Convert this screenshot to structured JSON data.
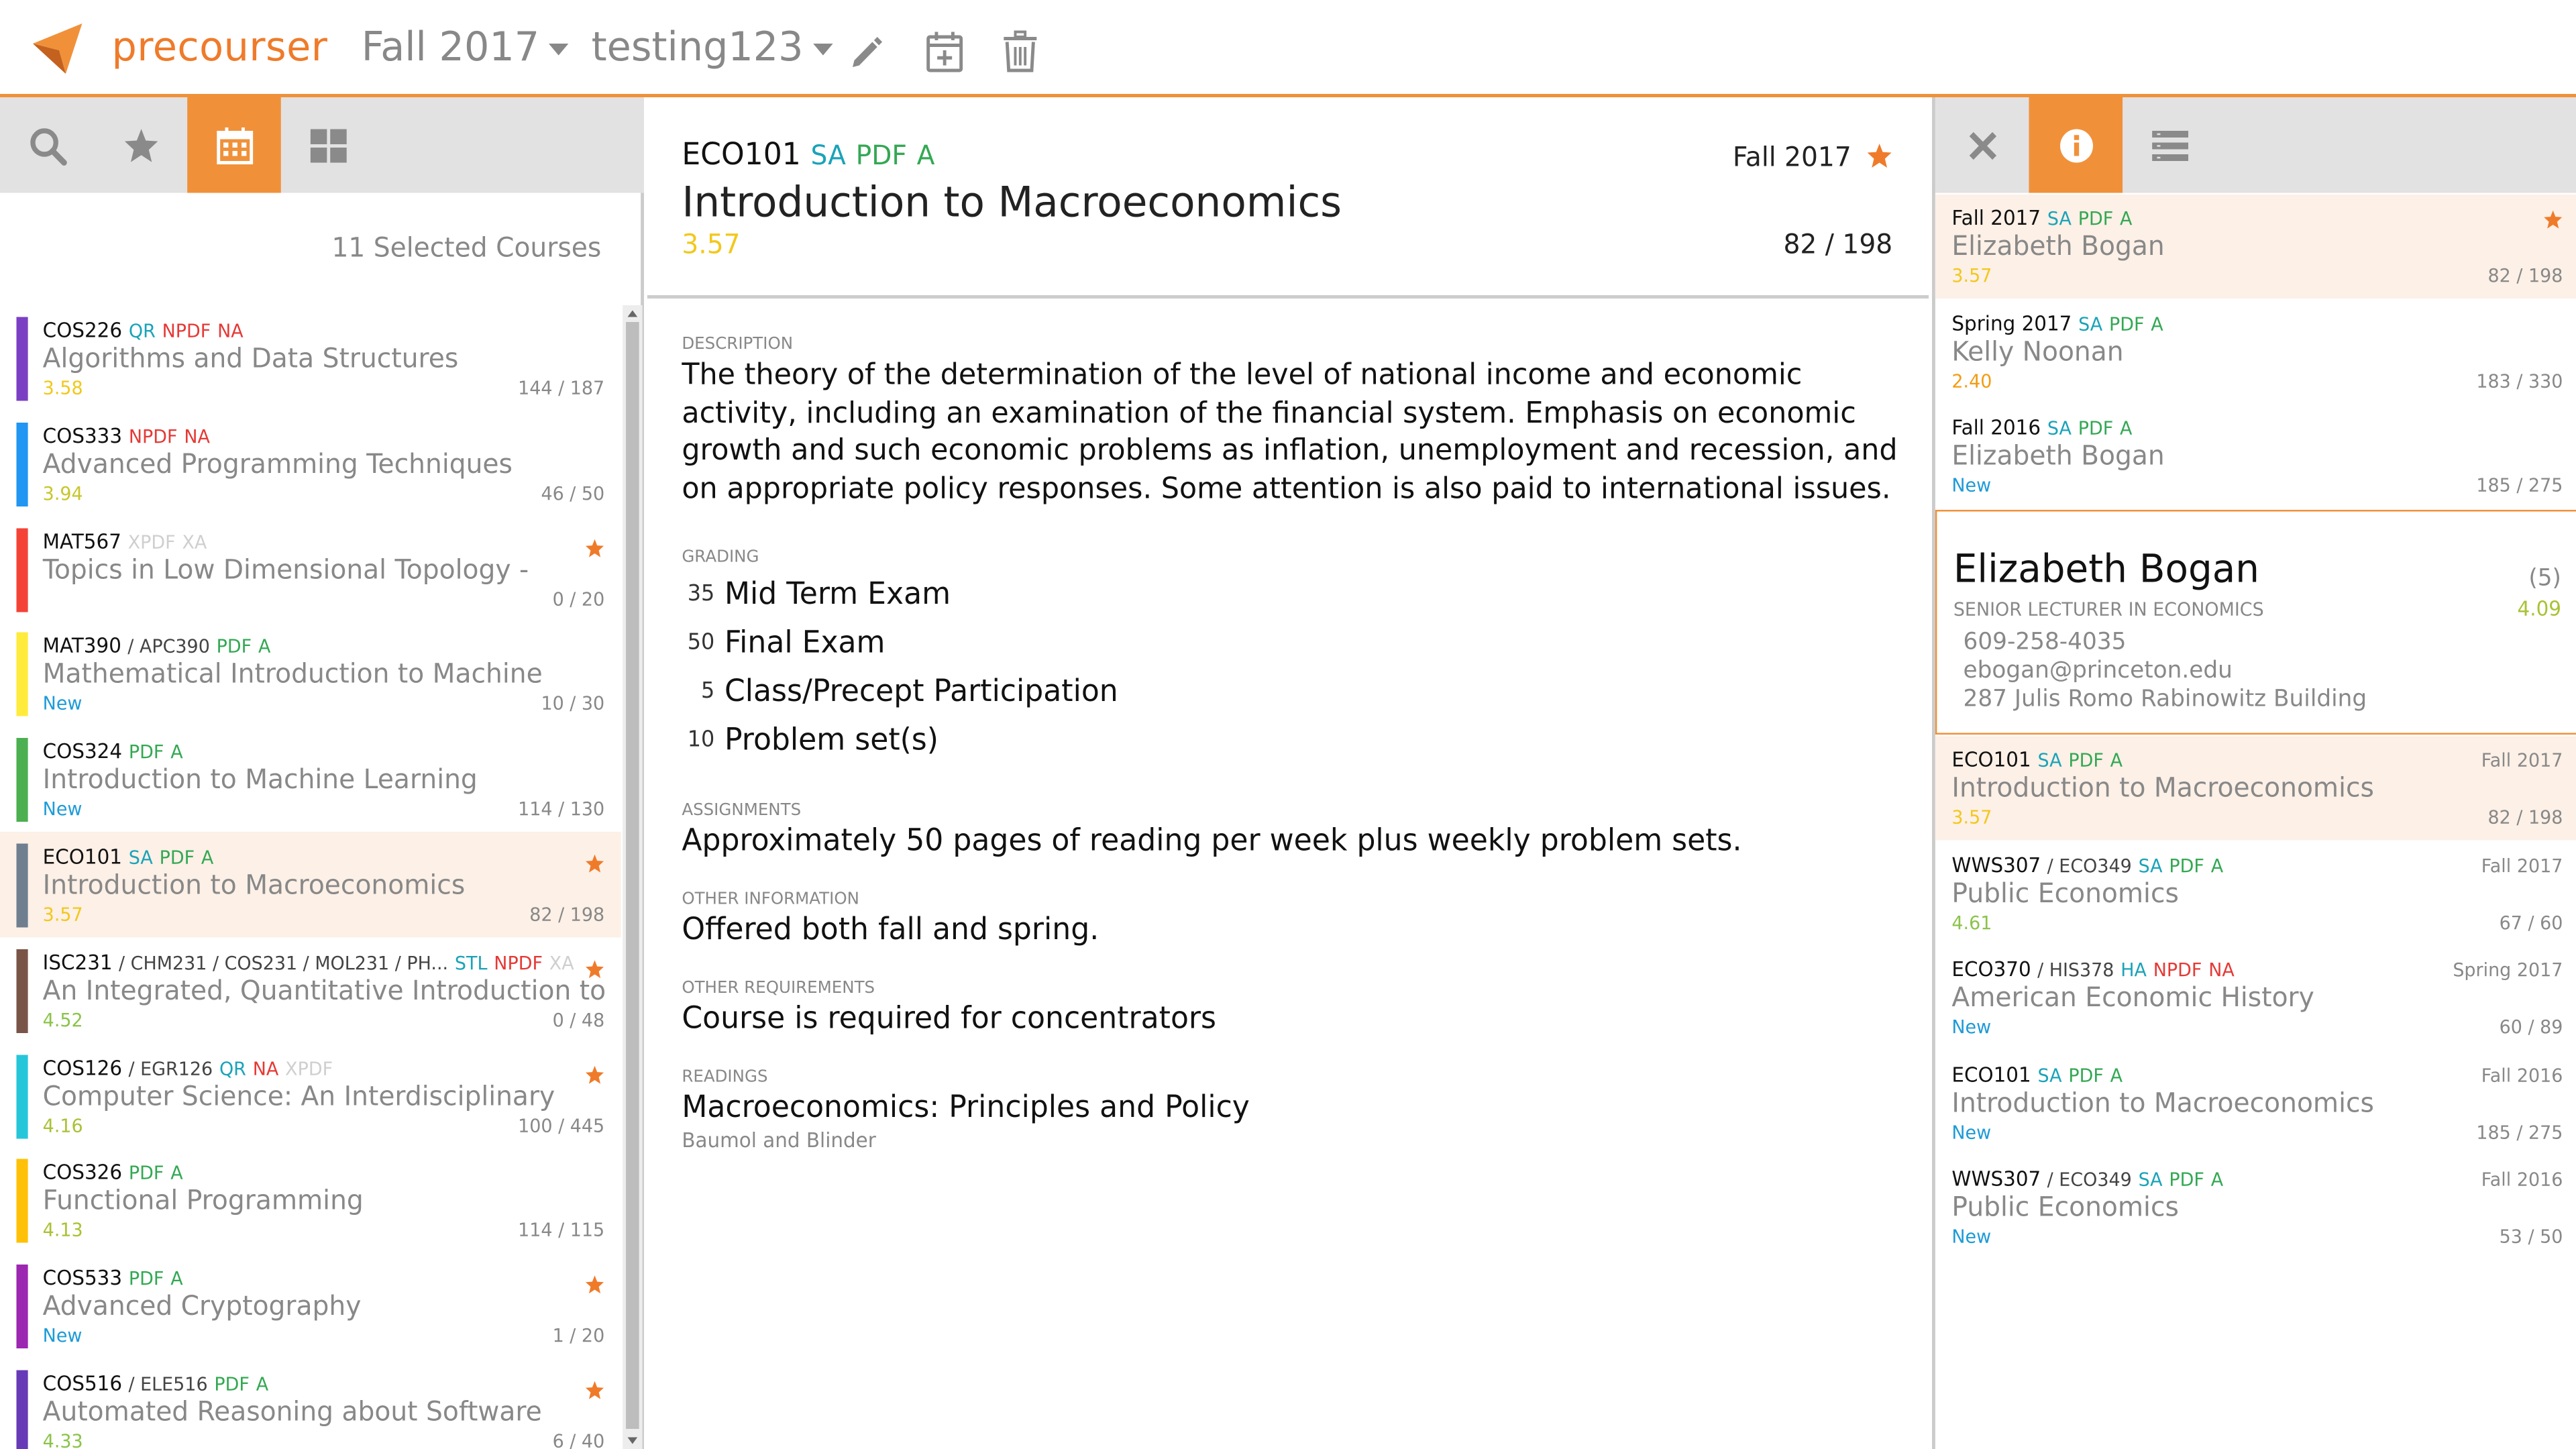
{
  "app": {
    "brand": "precourser",
    "semester": "Fall 2017",
    "schedule": "testing123",
    "accent_color": "#f0913a"
  },
  "left": {
    "selected_count": "11 Selected Courses",
    "courses": [
      {
        "code": "COS226",
        "cross": "",
        "tags": [
          {
            "t": "QR",
            "c": "qr"
          },
          {
            "t": "NPDF",
            "c": "npdf"
          },
          {
            "t": "NA",
            "c": "na"
          }
        ],
        "title": "Algorithms and Data Structures",
        "score": "3.58",
        "score_color": "#f2c81c",
        "enroll": "144 / 187",
        "bar": "#7b3fc4",
        "starred": false,
        "selected": false
      },
      {
        "code": "COS333",
        "cross": "",
        "tags": [
          {
            "t": "NPDF",
            "c": "npdf"
          },
          {
            "t": "NA",
            "c": "na"
          }
        ],
        "title": "Advanced Programming Techniques",
        "score": "3.94",
        "score_color": "#c8c62a",
        "enroll": "46 / 50",
        "bar": "#2196f3",
        "starred": false,
        "selected": false
      },
      {
        "code": "MAT567",
        "cross": "",
        "tags": [
          {
            "t": "XPDF",
            "c": "off"
          },
          {
            "t": "XA",
            "c": "off"
          }
        ],
        "title": "Topics in Low Dimensional Topology -",
        "score": "",
        "score_color": "#f2c81c",
        "enroll": "0 / 20",
        "bar": "#f44336",
        "starred": true,
        "selected": false
      },
      {
        "code": "MAT390",
        "cross": "/ APC390",
        "tags": [
          {
            "t": "PDF",
            "c": "pdf"
          },
          {
            "t": "A",
            "c": "a"
          }
        ],
        "title": "Mathematical Introduction to Machine",
        "score": "New",
        "score_color": "#1e9bd7",
        "enroll": "10 / 30",
        "bar": "#ffeb3b",
        "starred": false,
        "selected": false
      },
      {
        "code": "COS324",
        "cross": "",
        "tags": [
          {
            "t": "PDF",
            "c": "pdf"
          },
          {
            "t": "A",
            "c": "a"
          }
        ],
        "title": "Introduction to Machine Learning",
        "score": "New",
        "score_color": "#1e9bd7",
        "enroll": "114 / 130",
        "bar": "#4caf50",
        "starred": false,
        "selected": false
      },
      {
        "code": "ECO101",
        "cross": "",
        "tags": [
          {
            "t": "SA",
            "c": "sa"
          },
          {
            "t": "PDF",
            "c": "pdf"
          },
          {
            "t": "A",
            "c": "a"
          }
        ],
        "title": "Introduction to Macroeconomics",
        "score": "3.57",
        "score_color": "#f2c81c",
        "enroll": "82 / 198",
        "bar": "#6f7f8f",
        "starred": true,
        "selected": true
      },
      {
        "code": "ISC231",
        "cross": "/ CHM231 / COS231 / MOL231 / PH...",
        "tags": [
          {
            "t": "STL",
            "c": "stl"
          },
          {
            "t": "NPDF",
            "c": "npdf"
          },
          {
            "t": "XA",
            "c": "off"
          }
        ],
        "title": "An Integrated, Quantitative Introduction to",
        "score": "4.52",
        "score_color": "#8bc34a",
        "enroll": "0 / 48",
        "bar": "#795548",
        "starred": true,
        "selected": false
      },
      {
        "code": "COS126",
        "cross": "/ EGR126",
        "tags": [
          {
            "t": "QR",
            "c": "qr"
          },
          {
            "t": "NA",
            "c": "na"
          },
          {
            "t": "XPDF",
            "c": "off"
          }
        ],
        "title": "Computer Science: An Interdisciplinary",
        "score": "4.16",
        "score_color": "#a8c234",
        "enroll": "100 / 445",
        "bar": "#26c6da",
        "starred": true,
        "selected": false
      },
      {
        "code": "COS326",
        "cross": "",
        "tags": [
          {
            "t": "PDF",
            "c": "pdf"
          },
          {
            "t": "A",
            "c": "a"
          }
        ],
        "title": "Functional Programming",
        "score": "4.13",
        "score_color": "#a8c234",
        "enroll": "114 / 115",
        "bar": "#ffc107",
        "starred": false,
        "selected": false
      },
      {
        "code": "COS533",
        "cross": "",
        "tags": [
          {
            "t": "PDF",
            "c": "pdf"
          },
          {
            "t": "A",
            "c": "a"
          }
        ],
        "title": "Advanced Cryptography",
        "score": "New",
        "score_color": "#1e9bd7",
        "enroll": "1 / 20",
        "bar": "#9c27b0",
        "starred": true,
        "selected": false
      },
      {
        "code": "COS516",
        "cross": "/ ELE516",
        "tags": [
          {
            "t": "PDF",
            "c": "pdf"
          },
          {
            "t": "A",
            "c": "a"
          }
        ],
        "title": "Automated Reasoning about Software",
        "score": "4.33",
        "score_color": "#8bc34a",
        "enroll": "6 / 40",
        "bar": "#673ab7",
        "starred": true,
        "selected": false
      }
    ]
  },
  "course": {
    "code": "ECO101",
    "tags": [
      {
        "t": "SA",
        "c": "sa"
      },
      {
        "t": "PDF",
        "c": "pdf"
      },
      {
        "t": "A",
        "c": "a"
      }
    ],
    "title": "Introduction to Macroeconomics",
    "score": "3.57",
    "semester": "Fall 2017",
    "enrollment": "82 / 198",
    "description_label": "DESCRIPTION",
    "description": "The theory of the determination of the level of national income and economic activity, including an examination of the financial system. Emphasis on economic growth and such economic problems as inflation, unemployment and recession, and on appropriate policy responses. Some attention is also paid to international issues.",
    "grading_label": "GRADING",
    "grading": [
      {
        "pct": "35",
        "item": "Mid Term Exam"
      },
      {
        "pct": "50",
        "item": "Final Exam"
      },
      {
        "pct": "5",
        "item": "Class/Precept Participation"
      },
      {
        "pct": "10",
        "item": "Problem set(s)"
      }
    ],
    "assignments_label": "ASSIGNMENTS",
    "assignments": "Approximately 50 pages of reading per week plus weekly problem sets.",
    "other_info_label": "OTHER INFORMATION",
    "other_info": "Offered both fall and spring.",
    "other_req_label": "OTHER REQUIREMENTS",
    "other_req": "Course is required for concentrators",
    "readings_label": "READINGS",
    "reading_title": "Macroeconomics: Principles and Policy",
    "reading_authors": "Baumol and Blinder"
  },
  "right": {
    "past_offerings": [
      {
        "semester": "Fall 2017",
        "tags": [
          {
            "t": "SA",
            "c": "sa"
          },
          {
            "t": "PDF",
            "c": "pdf"
          },
          {
            "t": "A",
            "c": "a"
          }
        ],
        "instructor": "Elizabeth Bogan",
        "score": "3.57",
        "score_color": "#f2c81c",
        "enroll": "82 / 198",
        "starred": true,
        "selected": true
      },
      {
        "semester": "Spring 2017",
        "tags": [
          {
            "t": "SA",
            "c": "sa"
          },
          {
            "t": "PDF",
            "c": "pdf"
          },
          {
            "t": "A",
            "c": "a"
          }
        ],
        "instructor": "Kelly Noonan",
        "score": "2.40",
        "score_color": "#f39c12",
        "enroll": "183 / 330",
        "starred": false,
        "selected": false
      },
      {
        "semester": "Fall 2016",
        "tags": [
          {
            "t": "SA",
            "c": "sa"
          },
          {
            "t": "PDF",
            "c": "pdf"
          },
          {
            "t": "A",
            "c": "a"
          }
        ],
        "instructor": "Elizabeth Bogan",
        "score": "New",
        "score_color": "#1e9bd7",
        "enroll": "185 / 275",
        "starred": false,
        "selected": false
      }
    ],
    "instructor": {
      "name": "Elizabeth Bogan",
      "title": "SENIOR LECTURER IN ECONOMICS",
      "count": "(5)",
      "score": "4.09",
      "phone": "609-258-4035",
      "email": "ebogan@princeton.edu",
      "office": "287 Julis Romo Rabinowitz Building"
    },
    "instructor_courses": [
      {
        "code": "ECO101",
        "cross": "",
        "tags": [
          {
            "t": "SA",
            "c": "sa"
          },
          {
            "t": "PDF",
            "c": "pdf"
          },
          {
            "t": "A",
            "c": "a"
          }
        ],
        "title": "Introduction to Macroeconomics",
        "semester": "Fall 2017",
        "score": "3.57",
        "score_color": "#f2c81c",
        "enroll": "82 / 198",
        "selected": true
      },
      {
        "code": "WWS307",
        "cross": "/ ECO349",
        "tags": [
          {
            "t": "SA",
            "c": "sa"
          },
          {
            "t": "PDF",
            "c": "pdf"
          },
          {
            "t": "A",
            "c": "a"
          }
        ],
        "title": "Public Economics",
        "semester": "Fall 2017",
        "score": "4.61",
        "score_color": "#8bc34a",
        "enroll": "67 / 60",
        "selected": false
      },
      {
        "code": "ECO370",
        "cross": "/ HIS378",
        "tags": [
          {
            "t": "HA",
            "c": "ha"
          },
          {
            "t": "NPDF",
            "c": "npdf"
          },
          {
            "t": "NA",
            "c": "na"
          }
        ],
        "title": "American Economic History",
        "semester": "Spring 2017",
        "score": "New",
        "score_color": "#1e9bd7",
        "enroll": "60 / 89",
        "selected": false
      },
      {
        "code": "ECO101",
        "cross": "",
        "tags": [
          {
            "t": "SA",
            "c": "sa"
          },
          {
            "t": "PDF",
            "c": "pdf"
          },
          {
            "t": "A",
            "c": "a"
          }
        ],
        "title": "Introduction to Macroeconomics",
        "semester": "Fall 2016",
        "score": "New",
        "score_color": "#1e9bd7",
        "enroll": "185 / 275",
        "selected": false
      },
      {
        "code": "WWS307",
        "cross": "/ ECO349",
        "tags": [
          {
            "t": "SA",
            "c": "sa"
          },
          {
            "t": "PDF",
            "c": "pdf"
          },
          {
            "t": "A",
            "c": "a"
          }
        ],
        "title": "Public Economics",
        "semester": "Fall 2016",
        "score": "New",
        "score_color": "#1e9bd7",
        "enroll": "53 / 50",
        "selected": false
      }
    ]
  }
}
